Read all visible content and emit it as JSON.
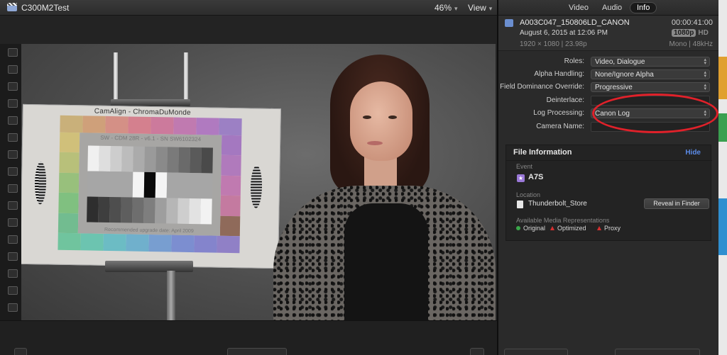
{
  "viewer": {
    "title": "C300M2Test",
    "zoom": "46%",
    "view_menu": "View",
    "chart_text": {
      "header": "CamAlign - ChromaDuMonde",
      "patch_label": "SW - CDM 28R - v6.1 - SN SW6102324",
      "footer_label": "Recommended upgrade date: April 2009"
    }
  },
  "inspector": {
    "tabs": [
      {
        "label": "Video",
        "active": false
      },
      {
        "label": "Audio",
        "active": false
      },
      {
        "label": "Info",
        "active": true
      }
    ],
    "clip": {
      "name": "A003C047_150806LD_CANON",
      "date": "August 6, 2015 at 12:06 PM",
      "timecode": "00:00:41:00",
      "res_active": "1080p",
      "res_inactive": "HD",
      "format": "1920 × 1080  |  23.98p",
      "audio": "Mono  |  48kHz"
    },
    "properties": [
      {
        "label": "Roles:",
        "value": "Video, Dialogue",
        "kind": "select"
      },
      {
        "label": "Alpha Handling:",
        "value": "None/Ignore Alpha",
        "kind": "select"
      },
      {
        "label": "Field Dominance Override:",
        "value": "Progressive",
        "kind": "select"
      },
      {
        "label": "Deinterlace:",
        "value": "",
        "kind": "field"
      },
      {
        "label": "Log Processing:",
        "value": "Canon Log",
        "kind": "select"
      },
      {
        "label": "Camera Name:",
        "value": "",
        "kind": "field"
      }
    ],
    "file_info": {
      "title": "File Information",
      "hide": "Hide",
      "event_label": "Event",
      "event": "A7S",
      "location_label": "Location",
      "location": "Thunderbolt_Store",
      "reveal_button": "Reveal in Finder",
      "reps_label": "Available Media Representations",
      "reps": [
        {
          "label": "Original",
          "status": "available"
        },
        {
          "label": "Optimized",
          "status": "missing"
        },
        {
          "label": "Proxy",
          "status": "missing"
        }
      ]
    }
  },
  "colors": {
    "accent_link": "#5b8be8",
    "annotation_ring": "#e0212a",
    "available": "#3aa84a",
    "missing": "#d63030"
  }
}
